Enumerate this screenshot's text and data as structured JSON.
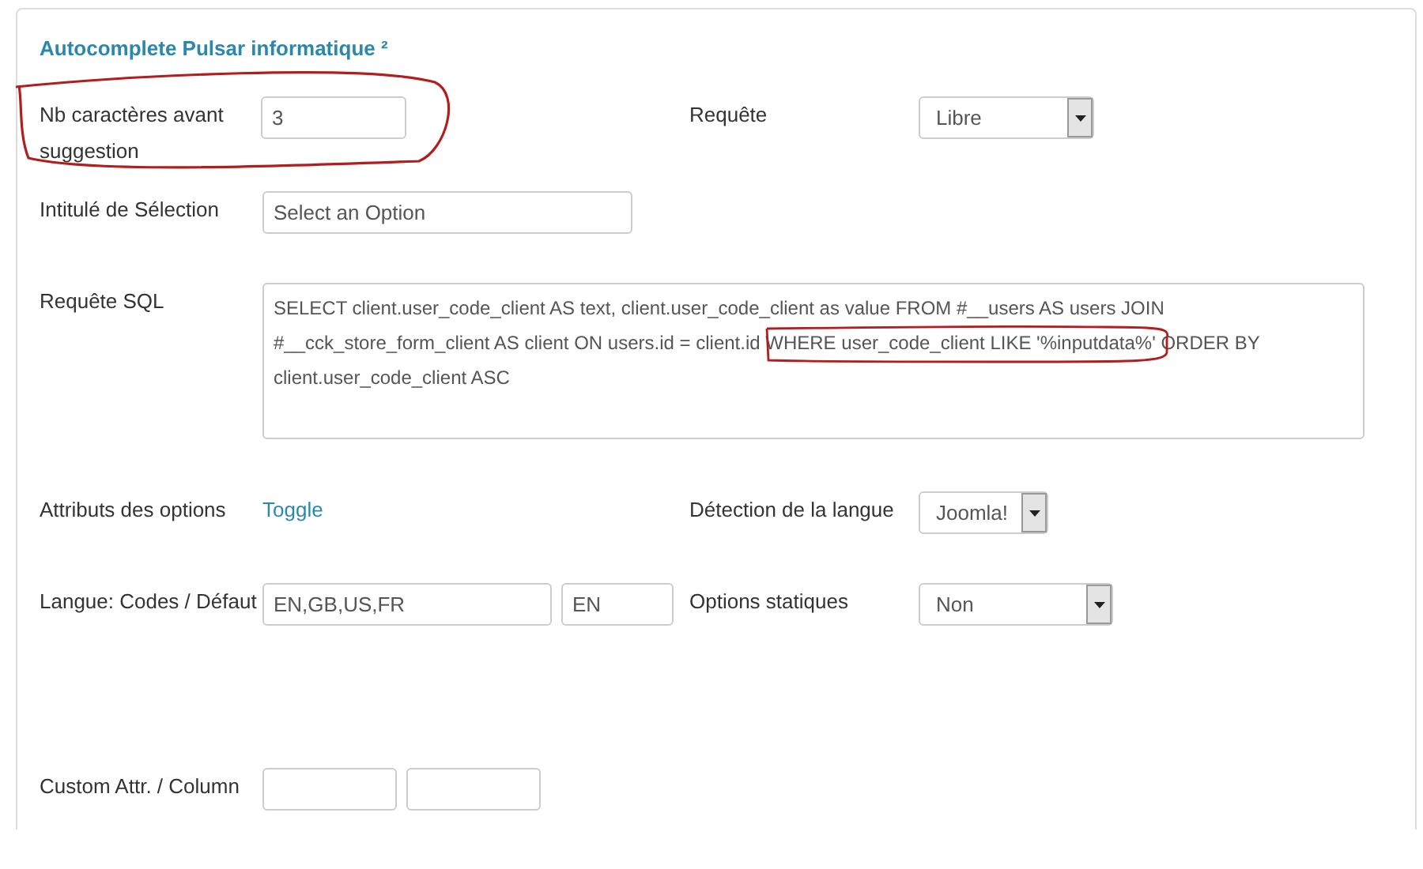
{
  "section": {
    "title": "Autocomplete Pulsar informatique ²"
  },
  "nb_caracteres": {
    "label": "Nb caractères avant suggestion",
    "value": "3"
  },
  "requete": {
    "label": "Requête",
    "value": "Libre"
  },
  "intitule": {
    "label": "Intitulé de Sélection",
    "value": "Select an Option"
  },
  "requete_sql": {
    "label": "Requête SQL",
    "value": "SELECT client.user_code_client AS text, client.user_code_client as value FROM #__users AS users JOIN #__cck_store_form_client AS client ON users.id = client.id WHERE user_code_client LIKE '%inputdata%' ORDER BY client.user_code_client ASC"
  },
  "attributs": {
    "label": "Attributs des options",
    "link": "Toggle"
  },
  "detection": {
    "label": "Détection de la langue",
    "value": "Joomla!"
  },
  "langue": {
    "label": "Langue: Codes / Défaut",
    "codes": "EN,GB,US,FR",
    "default": "EN"
  },
  "options_statiques": {
    "label": "Options statiques",
    "value": "Non"
  },
  "custom": {
    "label": "Custom Attr. / Column"
  }
}
